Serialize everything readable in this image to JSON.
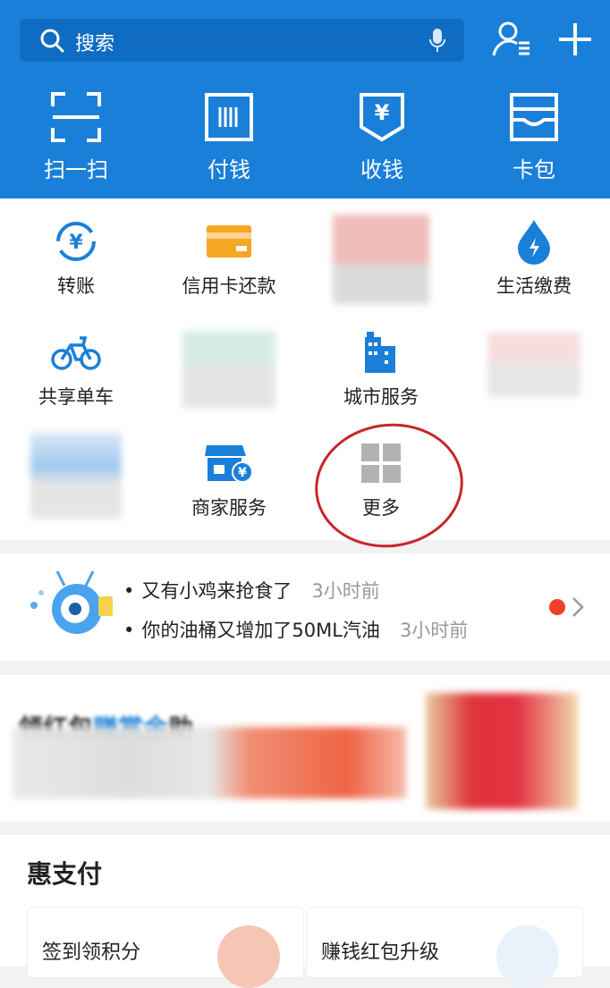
{
  "search": {
    "placeholder": "搜索"
  },
  "quick_actions": [
    {
      "label": "扫一扫",
      "icon": "scan-icon"
    },
    {
      "label": "付钱",
      "icon": "barcode-pay-icon"
    },
    {
      "label": "收钱",
      "icon": "receive-money-icon"
    },
    {
      "label": "卡包",
      "icon": "card-wallet-icon"
    }
  ],
  "apps": [
    {
      "label": "转账",
      "icon": "transfer-icon"
    },
    {
      "label": "信用卡还款",
      "icon": "credit-card-icon"
    },
    {
      "label": "生活缴费",
      "icon": "utility-drop-icon"
    },
    {
      "label": "共享单车",
      "icon": "bicycle-icon"
    },
    {
      "label": "城市服务",
      "icon": "city-building-icon"
    },
    {
      "label": "商家服务",
      "icon": "merchant-store-icon"
    },
    {
      "label": "更多",
      "icon": "more-grid-icon"
    }
  ],
  "notices": [
    {
      "text": "又有小鸡来抢食了",
      "time": "3小时前"
    },
    {
      "text": "你的油桶又增加了50ML汽油",
      "time": "3小时前"
    }
  ],
  "promo": {
    "title_part1": "领红包",
    "title_highlight": "赚赏金",
    "title_part2": "助"
  },
  "hui": {
    "title": "惠支付",
    "cards": [
      "签到领积分",
      "赚钱红包升级"
    ]
  },
  "colors": {
    "brand_blue": "#1a7fd9",
    "annotation_red": "#c8252c",
    "notice_dot": "#f0402a"
  }
}
